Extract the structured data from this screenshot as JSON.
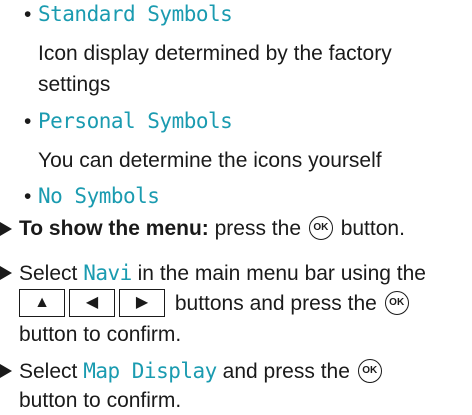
{
  "options": [
    {
      "name": "Standard Symbols",
      "description": "Icon display determined by the factory settings",
      "description_line1": "Icon display determined by the factory",
      "description_line2": "settings"
    },
    {
      "name": "Personal Symbols",
      "description": "You can determine the icons yourself"
    },
    {
      "name": "No Symbols"
    }
  ],
  "steps": {
    "show_menu": {
      "label": "To show the menu:",
      "text_before": "press the",
      "text_after": "button."
    },
    "select_navi": {
      "prefix": "Select",
      "item": "Navi",
      "line1_rest": "in the main menu bar using the",
      "line2_rest": "buttons and press the",
      "line3": "button to confirm."
    },
    "select_map": {
      "prefix": "Select",
      "item": "Map Display",
      "line1_rest": "and press the",
      "line2": "button to confirm."
    }
  },
  "ok_label": "OK",
  "arrow_buttons": [
    "up-arrow",
    "left-arrow",
    "right-arrow"
  ],
  "arrow_glyphs": [
    "▲",
    "◀",
    "▶"
  ],
  "colors": {
    "menu_item": "#1a9bb0",
    "text": "#1a1a1a"
  }
}
